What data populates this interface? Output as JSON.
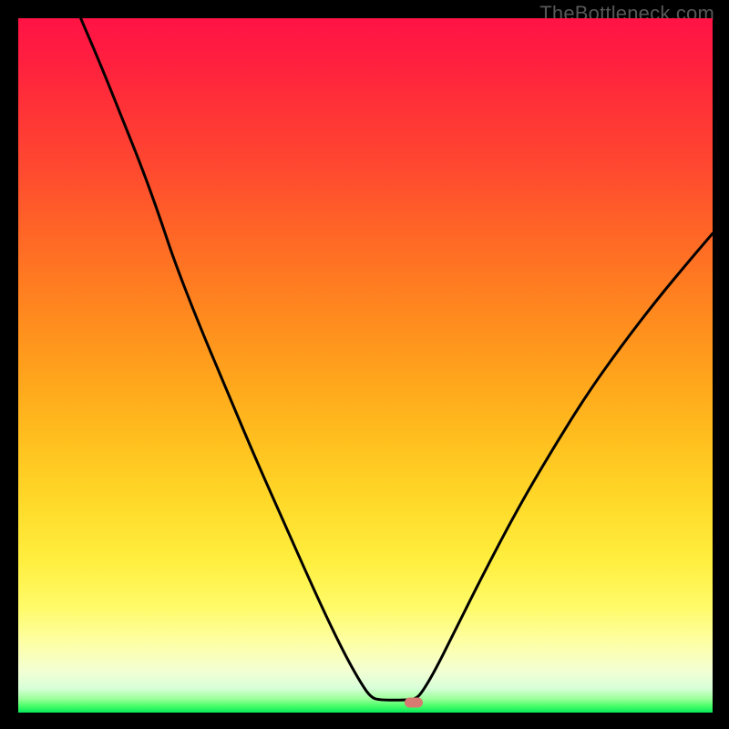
{
  "watermark": "TheBottleneck.com",
  "chart_data": {
    "type": "line",
    "title": "",
    "xlabel": "",
    "ylabel": "",
    "xlim": [
      0,
      1
    ],
    "ylim": [
      0,
      1
    ],
    "background_gradient": {
      "direction": "vertical",
      "stops": [
        {
          "pos": 0.0,
          "color": "#ff1345"
        },
        {
          "pos": 0.06,
          "color": "#ff1f3f"
        },
        {
          "pos": 0.14,
          "color": "#ff3536"
        },
        {
          "pos": 0.22,
          "color": "#ff4a2f"
        },
        {
          "pos": 0.3,
          "color": "#ff6327"
        },
        {
          "pos": 0.38,
          "color": "#ff7b21"
        },
        {
          "pos": 0.46,
          "color": "#ff931d"
        },
        {
          "pos": 0.54,
          "color": "#ffab1c"
        },
        {
          "pos": 0.62,
          "color": "#ffc31f"
        },
        {
          "pos": 0.7,
          "color": "#ffda2a"
        },
        {
          "pos": 0.78,
          "color": "#ffee3e"
        },
        {
          "pos": 0.85,
          "color": "#fffb6a"
        },
        {
          "pos": 0.9,
          "color": "#fdffa6"
        },
        {
          "pos": 0.94,
          "color": "#f3ffd3"
        },
        {
          "pos": 0.965,
          "color": "#d8ffd8"
        },
        {
          "pos": 0.98,
          "color": "#9cff9c"
        },
        {
          "pos": 0.99,
          "color": "#4cff6a"
        },
        {
          "pos": 1.0,
          "color": "#08e85a"
        }
      ]
    },
    "series": [
      {
        "name": "bottleneck-curve",
        "color": "#000000",
        "stroke_width": 3,
        "points": [
          {
            "x": 0.09,
            "y": 1.0
          },
          {
            "x": 0.12,
            "y": 0.93
          },
          {
            "x": 0.15,
            "y": 0.855
          },
          {
            "x": 0.18,
            "y": 0.78
          },
          {
            "x": 0.205,
            "y": 0.71
          },
          {
            "x": 0.225,
            "y": 0.65
          },
          {
            "x": 0.26,
            "y": 0.56
          },
          {
            "x": 0.3,
            "y": 0.465
          },
          {
            "x": 0.34,
            "y": 0.37
          },
          {
            "x": 0.38,
            "y": 0.28
          },
          {
            "x": 0.42,
            "y": 0.19
          },
          {
            "x": 0.45,
            "y": 0.125
          },
          {
            "x": 0.475,
            "y": 0.075
          },
          {
            "x": 0.495,
            "y": 0.04
          },
          {
            "x": 0.508,
            "y": 0.022
          },
          {
            "x": 0.52,
            "y": 0.018
          },
          {
            "x": 0.56,
            "y": 0.018
          },
          {
            "x": 0.573,
            "y": 0.02
          },
          {
            "x": 0.582,
            "y": 0.03
          },
          {
            "x": 0.6,
            "y": 0.06
          },
          {
            "x": 0.63,
            "y": 0.12
          },
          {
            "x": 0.67,
            "y": 0.2
          },
          {
            "x": 0.72,
            "y": 0.295
          },
          {
            "x": 0.77,
            "y": 0.38
          },
          {
            "x": 0.82,
            "y": 0.46
          },
          {
            "x": 0.87,
            "y": 0.53
          },
          {
            "x": 0.92,
            "y": 0.595
          },
          {
            "x": 0.97,
            "y": 0.655
          },
          {
            "x": 1.0,
            "y": 0.69
          }
        ]
      }
    ],
    "marker": {
      "x": 0.57,
      "y": 0.015,
      "color": "#d97a72",
      "shape": "pill"
    }
  }
}
